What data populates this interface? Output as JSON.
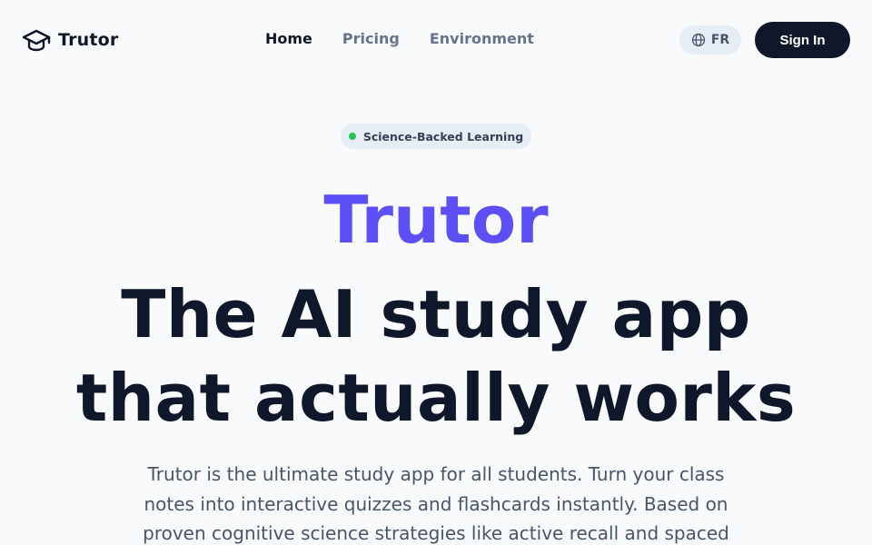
{
  "header": {
    "logo_text": "Trutor",
    "logo_icon": "graduation-cap-icon",
    "nav": [
      {
        "label": "Home",
        "active": true
      },
      {
        "label": "Pricing",
        "active": false
      },
      {
        "label": "Environment",
        "active": false
      }
    ],
    "language": {
      "label": "FR",
      "icon": "globe-icon"
    },
    "signin_label": "Sign In"
  },
  "hero": {
    "badge_label": "Science-Backed Learning",
    "brand_title": "Trutor",
    "headline": "The AI study app that actually works",
    "description": "Trutor is the ultimate study app for all students. Turn your class notes into interactive quizzes and flashcards instantly. Based on proven cognitive science strategies like active recall and spaced"
  },
  "colors": {
    "brand_accent": "#5b4ff5",
    "primary_dark": "#0f172a",
    "muted_text": "#64748b",
    "badge_dot": "#22c55e",
    "background": "#f8fafc"
  }
}
